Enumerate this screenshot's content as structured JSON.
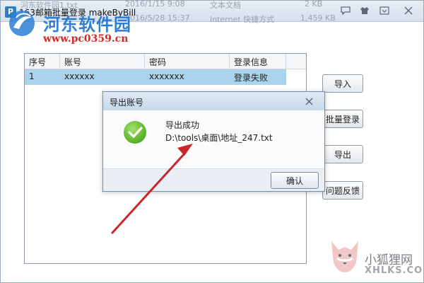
{
  "background": {
    "file_name": "河东软件园1.txt",
    "date1": "2016/1/15 9:08",
    "type1": "文本文档",
    "size1": "2 KB",
    "date2": "2016/5/28 15:37",
    "type2": "Internet 快捷方式",
    "size2": "1,459 KB"
  },
  "window": {
    "title": "163邮箱批量登录 makeByBill",
    "icon_letter": "P",
    "controls": [
      "chat-icon",
      "shirt-icon",
      "minimize-icon",
      "close-icon"
    ]
  },
  "watermark": {
    "site_name": "河东软件园",
    "site_url": "www.pc0359.cn"
  },
  "table": {
    "headers": [
      "序号",
      "账号",
      "密码",
      "登录信息"
    ],
    "rows": [
      [
        "1",
        "xxxxxx",
        "xxxxxxx",
        "登录失败"
      ]
    ]
  },
  "buttons": {
    "import": "导入",
    "batch_login": "批量登录",
    "export": "导出",
    "feedback": "问题反馈"
  },
  "dialog": {
    "title": "导出账号",
    "message": "导出成功",
    "path": "D:\\tools\\桌面\\地址_247.txt",
    "ok_label": "确认"
  },
  "footer_watermark": {
    "name_cn": "小狐狸网",
    "name_en": "XHLKS.COM"
  },
  "colors": {
    "row_selected": "#a9d3ea",
    "success_green": "#5db82e",
    "arrow_red": "#c8272a"
  }
}
